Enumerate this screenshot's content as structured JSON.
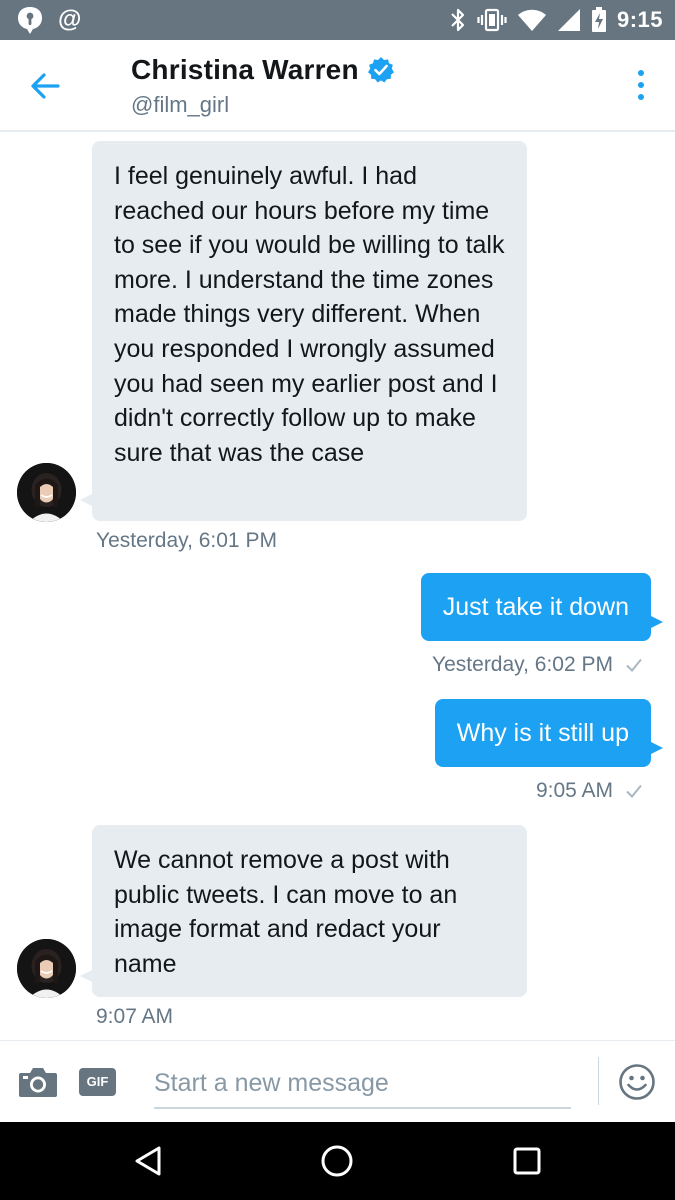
{
  "status_bar": {
    "time": "9:15",
    "left_icons": [
      "notification-icon",
      "at-icon"
    ],
    "right_icons": [
      "bluetooth-icon",
      "vibrate-icon",
      "wifi-icon",
      "signal-icon",
      "battery-charging-icon"
    ]
  },
  "header": {
    "name": "Christina Warren",
    "handle": "@film_girl",
    "verified": true
  },
  "messages": [
    {
      "direction": "incoming",
      "text": "I feel genuinely awful. I had reached our hours before my time to see if you would be willing to talk more. I understand the time zones made things very different. When you responded I wrongly assumed you had seen my earlier post and I didn't correctly follow up to make sure that was the case",
      "timestamp": "Yesterday, 6:01 PM"
    },
    {
      "direction": "outgoing",
      "text": "Just take it down",
      "timestamp": "Yesterday, 6:02 PM",
      "read": true
    },
    {
      "direction": "outgoing",
      "text": "Why is it still up",
      "timestamp": "9:05 AM",
      "read": true
    },
    {
      "direction": "incoming",
      "text": "We cannot remove a post with public tweets. I can move to an image format and redact your name",
      "timestamp": "9:07 AM"
    }
  ],
  "composer": {
    "placeholder": "Start a new message",
    "gif_label": "GIF"
  },
  "colors": {
    "accent": "#1da1f2",
    "incoming_bubble": "#e6ecf0",
    "status_bar": "#66757f",
    "secondary_text": "#657786"
  }
}
